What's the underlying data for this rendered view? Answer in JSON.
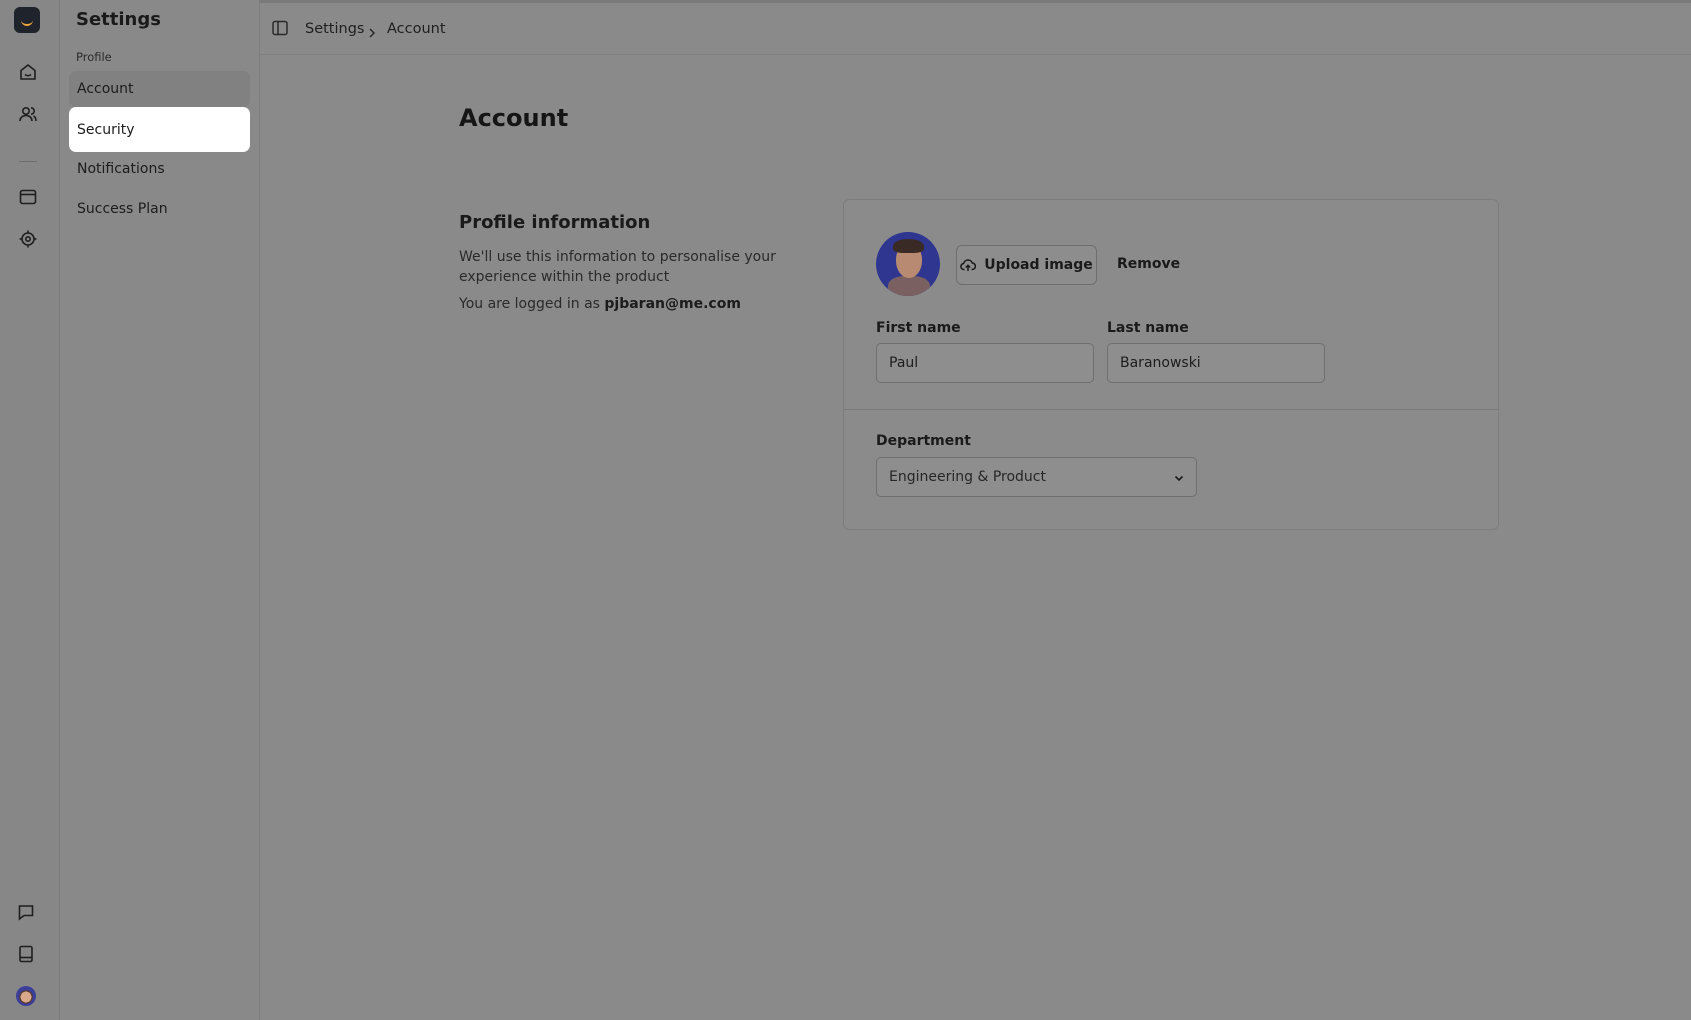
{
  "rail": {
    "icons": [
      "logo",
      "home-icon",
      "users-icon",
      "window-icon",
      "target-icon",
      "chat-icon",
      "book-icon",
      "user-avatar"
    ]
  },
  "sidebar": {
    "title": "Settings",
    "section": "Profile",
    "items": [
      {
        "label": "Account",
        "state": "current"
      },
      {
        "label": "Security",
        "state": "hover"
      },
      {
        "label": "Notifications",
        "state": "default"
      },
      {
        "label": "Success Plan",
        "state": "default"
      }
    ]
  },
  "breadcrumb": {
    "root": "Settings",
    "current": "Account"
  },
  "page": {
    "title": "Account"
  },
  "profile_info": {
    "title": "Profile information",
    "description": "We'll use this information to personalise your experience within the product",
    "login_prefix": "You are logged in as",
    "login_email": "pjbaran@me.com"
  },
  "card": {
    "upload_label": "Upload image",
    "remove_label": "Remove",
    "first_name_label": "First name",
    "first_name_value": "Paul",
    "last_name_label": "Last name",
    "last_name_value": "Baranowski",
    "department_label": "Department",
    "department_value": "Engineering & Product"
  },
  "colors": {
    "overlay_background": "#8a8a8a",
    "active_item_background": "#ffffff",
    "text": "#1c1c1c"
  }
}
